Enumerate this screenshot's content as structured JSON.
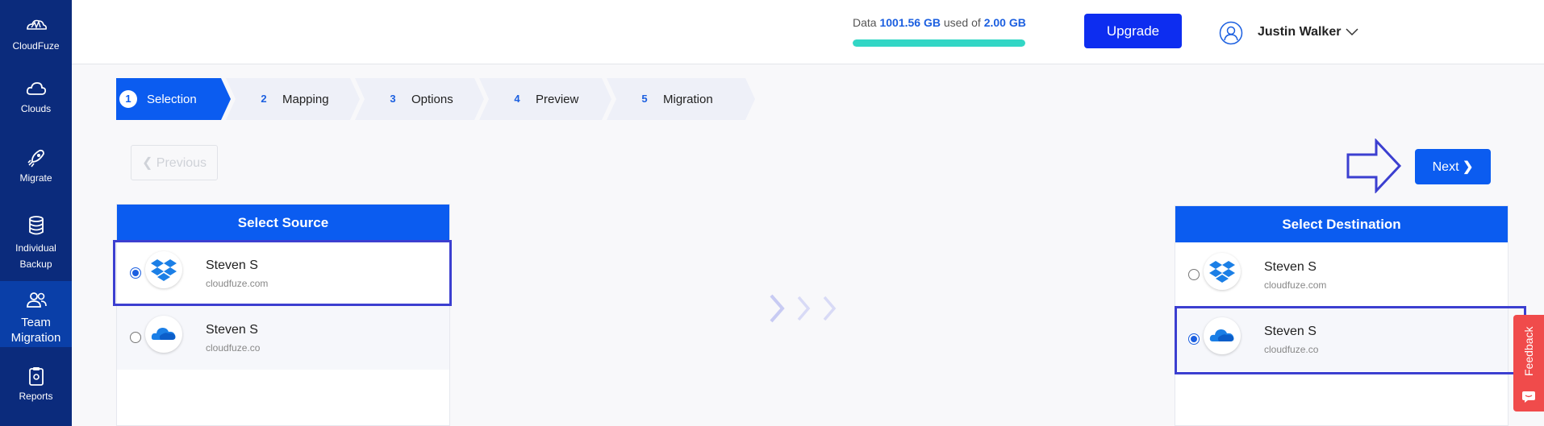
{
  "sidebar": {
    "brand": "CloudFuze",
    "items": [
      {
        "label": "Clouds"
      },
      {
        "label": "Migrate"
      },
      {
        "label": "Individual Backup"
      },
      {
        "label": "Team Migration",
        "active": true
      },
      {
        "label": "Reports"
      }
    ]
  },
  "header": {
    "usage_prefix": "Data",
    "usage_used": "1001.56 GB",
    "usage_mid": "used of",
    "usage_total": "2.00 GB",
    "usage_fill_percent": 100,
    "upgrade_label": "Upgrade",
    "user_name": "Justin Walker"
  },
  "steps": [
    {
      "num": "1",
      "label": "Selection",
      "active": true
    },
    {
      "num": "2",
      "label": "Mapping"
    },
    {
      "num": "3",
      "label": "Options"
    },
    {
      "num": "4",
      "label": "Preview"
    },
    {
      "num": "5",
      "label": "Migration"
    }
  ],
  "nav": {
    "previous_label": "Previous",
    "next_label": "Next"
  },
  "source": {
    "title": "Select Source",
    "accounts": [
      {
        "name": "Steven S",
        "domain": "cloudfuze.com",
        "cloud": "dropbox",
        "selected": true
      },
      {
        "name": "Steven S",
        "domain": "cloudfuze.co",
        "cloud": "onedrive",
        "selected": false
      }
    ]
  },
  "destination": {
    "title": "Select Destination",
    "accounts": [
      {
        "name": "Steven S",
        "domain": "cloudfuze.com",
        "cloud": "dropbox",
        "selected": false
      },
      {
        "name": "Steven S",
        "domain": "cloudfuze.co",
        "cloud": "onedrive",
        "selected": true
      }
    ]
  },
  "feedback_label": "Feedback",
  "colors": {
    "sidebar": "#0b2b7c",
    "accent": "#0b5cf0",
    "usage_bar": "#32d6c5",
    "highlight": "#3c3fd0",
    "feedback": "#f04b4b"
  },
  "icons": {
    "brand": "cloudfuze-logo-icon",
    "clouds": "cloud-icon",
    "migrate": "rocket-icon",
    "backup": "database-icon",
    "team": "users-icon",
    "reports": "clipboard-icon",
    "user": "user-circle-icon",
    "dropbox": "dropbox-icon",
    "onedrive": "onedrive-icon"
  }
}
